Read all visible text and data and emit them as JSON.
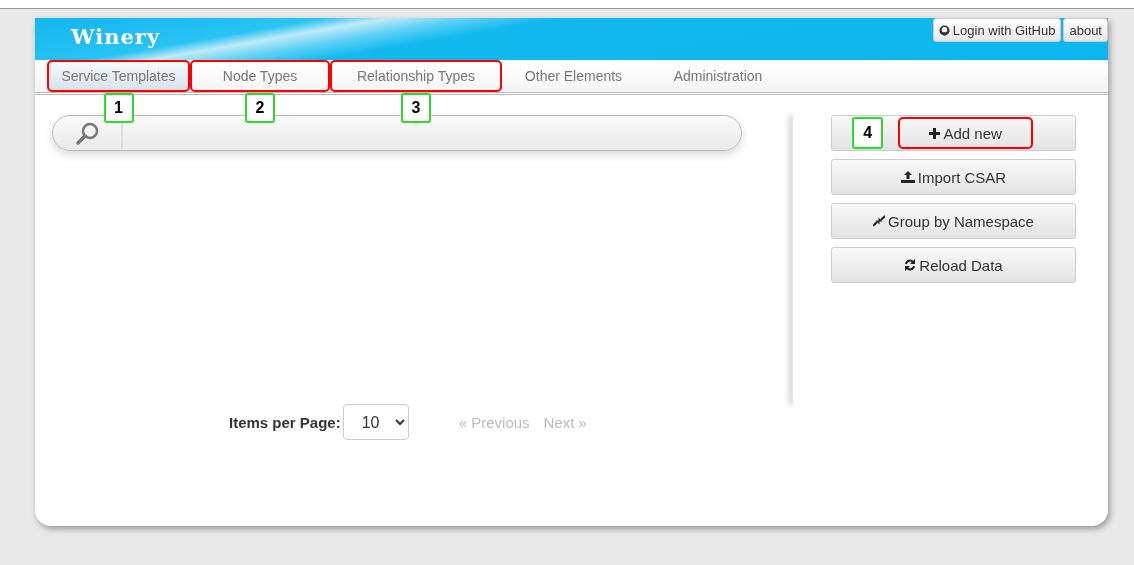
{
  "header": {
    "title": "Winery",
    "links": [
      {
        "label": "Login with GitHub"
      },
      {
        "label": "about"
      }
    ]
  },
  "tabs": [
    {
      "label": "Service Templates",
      "selected": true,
      "highlighted": true,
      "marker": "1"
    },
    {
      "label": "Node Types",
      "selected": false,
      "highlighted": true,
      "marker": "2"
    },
    {
      "label": "Relationship Types",
      "selected": false,
      "highlighted": true,
      "marker": "3"
    },
    {
      "label": "Other Elements",
      "selected": false,
      "highlighted": false
    },
    {
      "label": "Administration",
      "selected": false,
      "highlighted": false
    }
  ],
  "actions": [
    {
      "label": "Add new",
      "highlighted": true,
      "marker": "4"
    },
    {
      "label": "Import CSAR",
      "highlighted": false
    },
    {
      "label": "Group by Namespace",
      "highlighted": false
    },
    {
      "label": "Reload Data",
      "highlighted": false
    }
  ],
  "pager": {
    "label": "Items per Page:",
    "per_page": "10",
    "previous": {
      "label": "« Previous",
      "disabled": true
    },
    "next": {
      "label": "Next »",
      "disabled": true
    }
  }
}
